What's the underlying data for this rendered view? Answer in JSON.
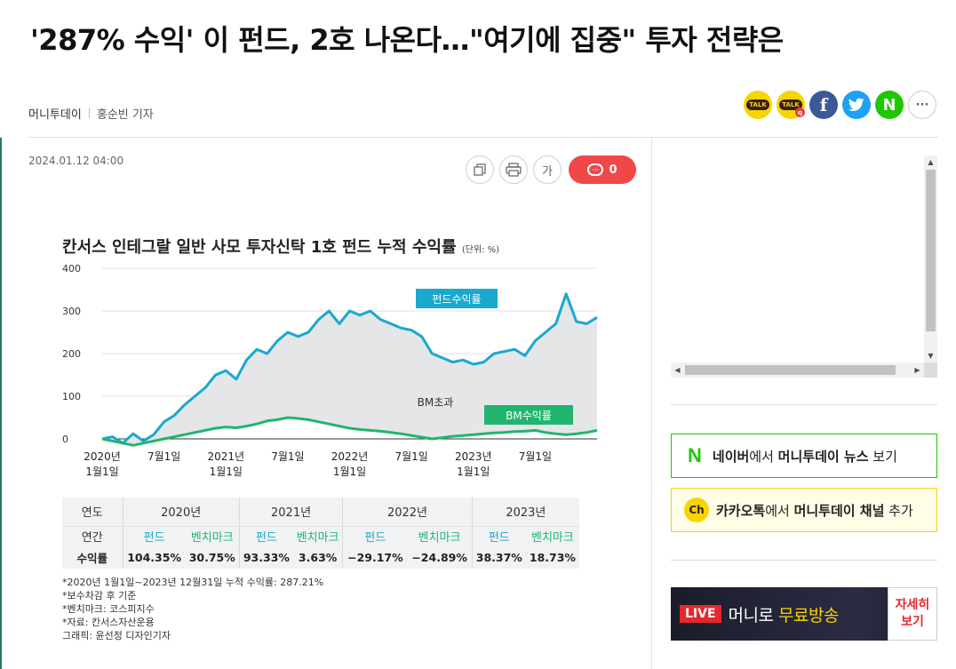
{
  "article": {
    "headline": "'287% 수익' 이 펀드, 2호 나온다…\"여기에 집중\" 투자 전략은",
    "source": "머니투데이",
    "reporter": "홍순빈 기자",
    "date": "2024.01.12  04:00"
  },
  "share": {
    "kakaotalk_label": "TALK",
    "kakaotalk2_label": "TALK",
    "facebook_label": "f",
    "twitter_label": "t",
    "naver_label": "N",
    "more_label": "···"
  },
  "tools": {
    "copy_icon": "copy-icon",
    "print_icon": "print-icon",
    "font_label": "가",
    "comment_count": "0"
  },
  "chart_data": {
    "type": "line",
    "title": "칸서스 인테그랄 일반 사모 투자신탁 1호 펀드 누적 수익률",
    "unit": "(단위: %)",
    "ylim": [
      0,
      400
    ],
    "yticks": [
      "400",
      "300",
      "200",
      "100",
      "0"
    ],
    "xticks": [
      {
        "line1": "2020년",
        "line2": "1월1일"
      },
      {
        "line1": "7월1일",
        "line2": ""
      },
      {
        "line1": "2021년",
        "line2": "1월1일"
      },
      {
        "line1": "7월1일",
        "line2": ""
      },
      {
        "line1": "2022년",
        "line2": "1월1일"
      },
      {
        "line1": "7월1일",
        "line2": ""
      },
      {
        "line1": "2023년",
        "line2": "1월1일"
      },
      {
        "line1": "7월1일",
        "line2": ""
      }
    ],
    "x_months": [
      0,
      1,
      2,
      3,
      4,
      5,
      6,
      7,
      8,
      9,
      10,
      11,
      12,
      13,
      14,
      15,
      16,
      17,
      18,
      19,
      20,
      21,
      22,
      23,
      24,
      25,
      26,
      27,
      28,
      29,
      30,
      31,
      32,
      33,
      34,
      35,
      36,
      37,
      38,
      39,
      40,
      41,
      42,
      43,
      44,
      45,
      46,
      47,
      48
    ],
    "series": [
      {
        "name": "펀드수익률",
        "color": "#1aa8cf",
        "values": [
          0,
          5,
          -10,
          12,
          -5,
          10,
          40,
          55,
          80,
          100,
          120,
          150,
          160,
          140,
          185,
          210,
          200,
          230,
          250,
          240,
          250,
          280,
          300,
          270,
          300,
          290,
          300,
          280,
          270,
          260,
          255,
          240,
          200,
          190,
          180,
          185,
          175,
          180,
          200,
          205,
          210,
          195,
          230,
          250,
          270,
          340,
          275,
          270,
          285
        ]
      },
      {
        "name": "BM수익률",
        "color": "#21b56f",
        "values": [
          0,
          -5,
          -10,
          -15,
          -10,
          -5,
          0,
          5,
          10,
          15,
          20,
          25,
          28,
          26,
          30,
          35,
          42,
          45,
          50,
          48,
          45,
          40,
          35,
          30,
          25,
          22,
          20,
          18,
          15,
          12,
          8,
          4,
          0,
          3,
          6,
          8,
          10,
          12,
          14,
          15,
          17,
          18,
          20,
          15,
          12,
          10,
          12,
          15,
          20
        ]
      }
    ],
    "annotations": [
      "펀드수익률",
      "BM수익률",
      "BM초과"
    ],
    "grid": true
  },
  "table": {
    "header_label": "연도",
    "row_label_1": "연간",
    "row_label_2": "수익률",
    "years": [
      "2020년",
      "2021년",
      "2022년",
      "2023년"
    ],
    "fund_label": "펀드",
    "bm_label": "벤치마크",
    "fund_values": [
      "104.35%",
      "93.33%",
      "−29.17%",
      "38.37%"
    ],
    "bm_values": [
      "30.75%",
      "3.63%",
      "−24.89%",
      "18.73%"
    ]
  },
  "notes": [
    "*2020년 1월1일~2023년 12월31일 누적 수익률: 287.21%",
    "*보수차감 후 기준",
    "*벤치마크: 코스피지수",
    "*자료: 칸서스자산운용",
    "그래픽: 윤선정 디자인기자"
  ],
  "sidebar": {
    "naver_mark": "N",
    "naver_text_a": "네이버",
    "naver_text_b": "에서 ",
    "naver_text_c": "머니투데이 뉴스",
    "naver_text_d": " 보기",
    "kakao_mark": "Ch",
    "kakao_text_a": "카카오톡",
    "kakao_text_b": "에서 ",
    "kakao_text_c": "머니투데이 채널",
    "kakao_text_d": " 추가",
    "live_tag": "LIVE",
    "live_text_a": "머니로 ",
    "live_text_b": "무료방송",
    "live_more_1": "자세히",
    "live_more_2": "보기"
  }
}
